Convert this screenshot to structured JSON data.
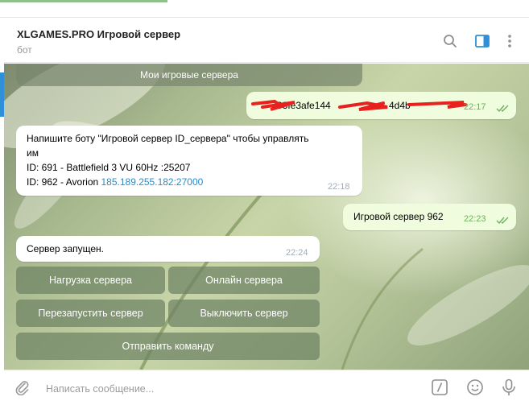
{
  "header": {
    "title": "XLGAMES.PRO Игровой сервер",
    "subtitle": "бот"
  },
  "top_keyboard": {
    "label": "Мои игровые сервера"
  },
  "messages": [
    {
      "direction": "out",
      "text": "93fe3afe144",
      "text2": "4d4b",
      "time": "22:17",
      "read": true
    },
    {
      "direction": "in",
      "line1": "Напишите боту \"Игровой сервер ID_сервера\" чтобы управлять",
      "line2": "им",
      "line3": "ID: 691 - Battlefield 3 VU 60Hz :25207",
      "line4_prefix": "ID: 962 - Avorion ",
      "line4_link": "185.189.255.182:27000",
      "time": "22:18"
    },
    {
      "direction": "out",
      "text": "Игровой сервер 962",
      "time": "22:23",
      "read": true
    },
    {
      "direction": "in",
      "text": "Сервер запущен.",
      "time": "22:24"
    }
  ],
  "keyboard": {
    "load": "Нагрузка сервера",
    "online": "Онлайн сервера",
    "restart": "Перезапустить сервер",
    "shutdown": "Выключить сервер",
    "send_command": "Отправить команду"
  },
  "input": {
    "placeholder": "Написать сообщение..."
  },
  "colors": {
    "accent": "#2f8fd8",
    "outgoing_bubble": "#effdde",
    "read_check": "#6cb05c",
    "link": "#2a8bc9"
  },
  "icons": [
    "search-icon",
    "sidebar-panel-icon",
    "more-vertical-icon",
    "attach-icon",
    "slash-command-icon",
    "emoji-icon",
    "microphone-icon"
  ]
}
